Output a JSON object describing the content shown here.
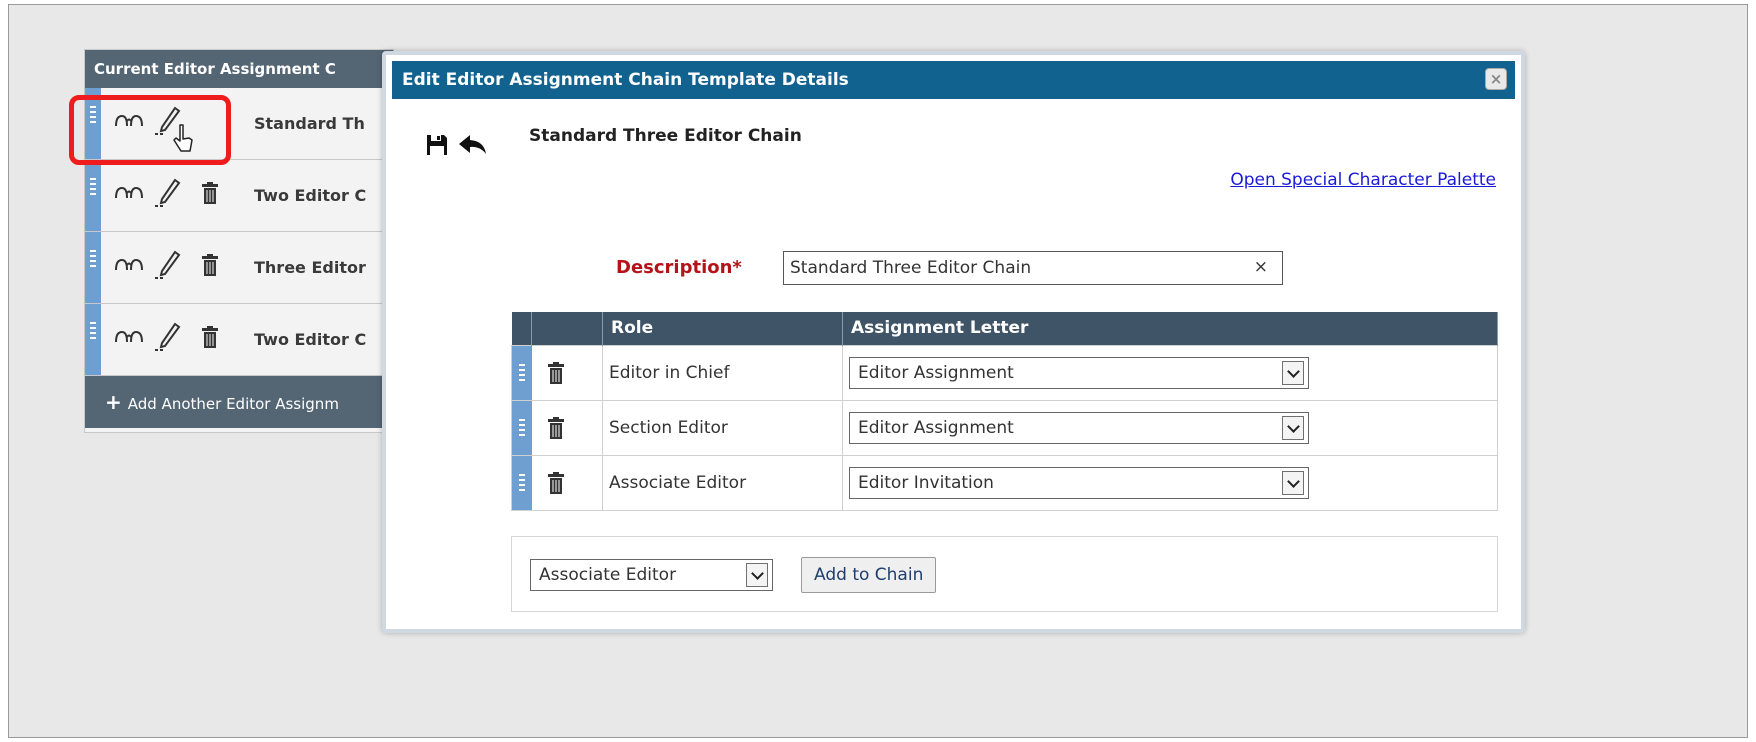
{
  "list": {
    "header": "Current Editor Assignment C",
    "rows": [
      {
        "title": "Standard Th"
      },
      {
        "title": "Two Editor C"
      },
      {
        "title": "Three Editor"
      },
      {
        "title": "Two Editor C"
      }
    ],
    "add_label": "Add Another Editor Assignm"
  },
  "modal": {
    "title": "Edit Editor Assignment Chain Template Details",
    "close_glyph": "×",
    "chain_name": "Standard Three Editor Chain",
    "palette_link": "Open Special Character Palette",
    "description_label": "Description*",
    "description_value": "Standard Three Editor Chain",
    "clear_glyph": "×",
    "table": {
      "headers": [
        "",
        "",
        "Role",
        "Assignment Letter"
      ],
      "rows": [
        {
          "role": "Editor in Chief",
          "letter": "Editor Assignment"
        },
        {
          "role": "Section Editor",
          "letter": "Editor Assignment"
        },
        {
          "role": "Associate Editor",
          "letter": "Editor Invitation"
        }
      ]
    },
    "add_role_selected": "Associate Editor",
    "add_button": "Add to Chain"
  },
  "icons": [
    "glasses-icon",
    "pencil-icon",
    "trash-icon",
    "save-icon",
    "back-arrow-icon",
    "plus-icon",
    "cursor-icon",
    "chevron-down-icon",
    "drag-handle-icon"
  ],
  "colors": {
    "header_bg": "#546574",
    "modal_title_bg": "#11628f",
    "table_header_bg": "#3f5466",
    "drag_handle": "#6f9fd0",
    "required_label": "#b3141a",
    "link": "#1a1ad8",
    "highlight": "#ee1c1c"
  }
}
